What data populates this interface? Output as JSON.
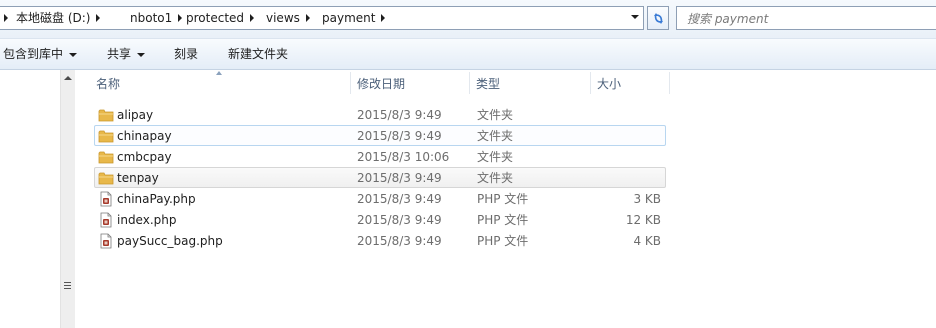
{
  "address_bar": {
    "crumbs": [
      "本地磁盘 (D:)",
      "nboto1",
      "protected",
      "views",
      "payment"
    ]
  },
  "search": {
    "placeholder": "搜索 payment"
  },
  "toolbar": {
    "include_library": "包含到库中",
    "share": "共享",
    "burn": "刻录",
    "new_folder": "新建文件夹"
  },
  "columns": {
    "name": "名称",
    "date": "修改日期",
    "type": "类型",
    "size": "大小"
  },
  "files": [
    {
      "name": "alipay",
      "date": "2015/8/3 9:49",
      "type": "文件夹",
      "size": "",
      "icon": "folder-icon",
      "state": "normal"
    },
    {
      "name": "chinapay",
      "date": "2015/8/3 9:49",
      "type": "文件夹",
      "size": "",
      "icon": "folder-icon",
      "state": "focused"
    },
    {
      "name": "cmbcpay",
      "date": "2015/8/3 10:06",
      "type": "文件夹",
      "size": "",
      "icon": "folder-icon",
      "state": "normal"
    },
    {
      "name": "tenpay",
      "date": "2015/8/3 9:49",
      "type": "文件夹",
      "size": "",
      "icon": "folder-icon",
      "state": "hovered"
    },
    {
      "name": "chinaPay.php",
      "date": "2015/8/3 9:49",
      "type": "PHP 文件",
      "size": "3 KB",
      "icon": "php-file-icon",
      "state": "normal"
    },
    {
      "name": "index.php",
      "date": "2015/8/3 9:49",
      "type": "PHP 文件",
      "size": "12 KB",
      "icon": "php-file-icon",
      "state": "normal"
    },
    {
      "name": "paySucc_bag.php",
      "date": "2015/8/3 9:49",
      "type": "PHP 文件",
      "size": "4 KB",
      "icon": "php-file-icon",
      "state": "normal"
    }
  ],
  "colors": {
    "folder": "#e8b84a",
    "focus_border": "#b8d6f0",
    "header_text": "#4c607a"
  }
}
